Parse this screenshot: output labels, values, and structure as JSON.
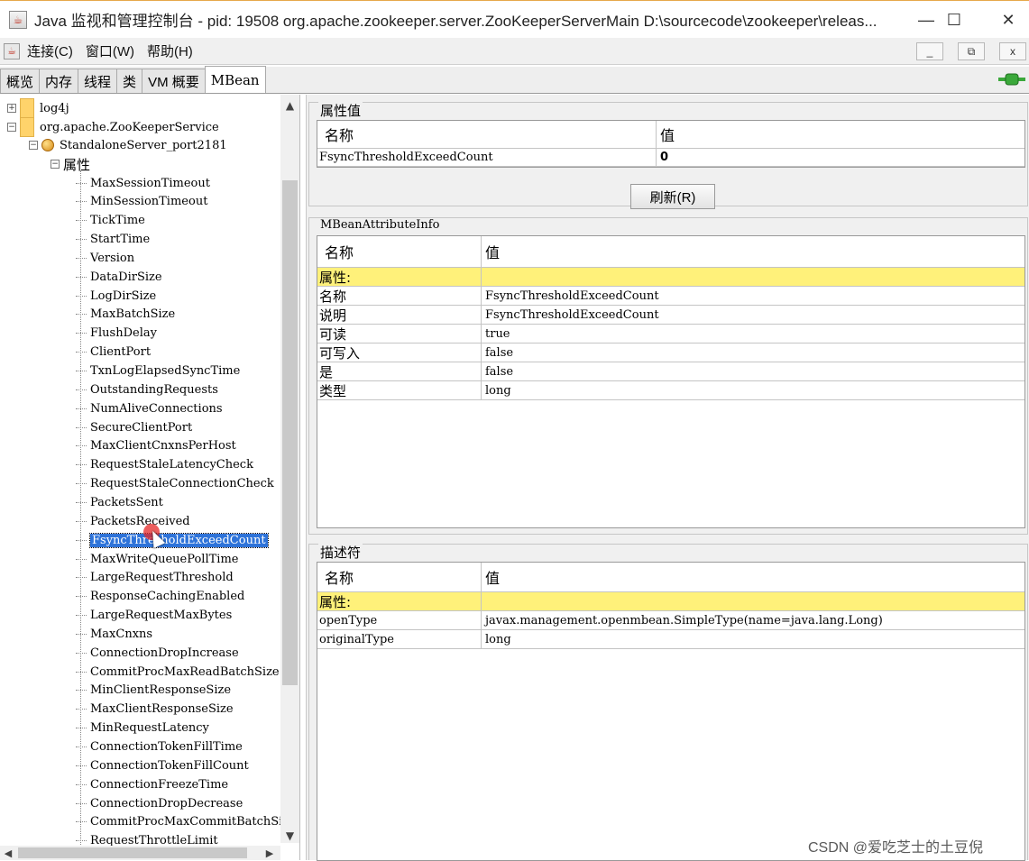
{
  "window": {
    "title": "Java 监视和管理控制台 - pid: 19508 org.apache.zookeeper.server.ZooKeeperServerMain D:\\sourcecode\\zookeeper\\releas...",
    "controls": {
      "minimize": "—",
      "maximize": "☐",
      "close": "✕"
    }
  },
  "menu": {
    "items": [
      "连接(C)",
      "窗口(W)",
      "帮助(H)"
    ],
    "mdi": {
      "minimize": "_",
      "restore": "⧉",
      "close": "x"
    }
  },
  "tabs": [
    "概览",
    "内存",
    "线程",
    "类",
    "VM 概要",
    "MBean"
  ],
  "active_tab": "MBean",
  "tree": {
    "nodes": {
      "log4j": "log4j",
      "service": "org.apache.ZooKeeperService",
      "server": "StandaloneServer_port2181",
      "attributes_folder": "属性"
    },
    "attributes": [
      "MaxSessionTimeout",
      "MinSessionTimeout",
      "TickTime",
      "StartTime",
      "Version",
      "DataDirSize",
      "LogDirSize",
      "MaxBatchSize",
      "FlushDelay",
      "ClientPort",
      "TxnLogElapsedSyncTime",
      "OutstandingRequests",
      "NumAliveConnections",
      "SecureClientPort",
      "MaxClientCnxnsPerHost",
      "RequestStaleLatencyCheck",
      "RequestStaleConnectionCheck",
      "PacketsSent",
      "PacketsReceived",
      "FsyncThresholdExceedCount",
      "MaxWriteQueuePollTime",
      "LargeRequestThreshold",
      "ResponseCachingEnabled",
      "LargeRequestMaxBytes",
      "MaxCnxns",
      "ConnectionDropIncrease",
      "CommitProcMaxReadBatchSize",
      "MinClientResponseSize",
      "MaxClientResponseSize",
      "MinRequestLatency",
      "ConnectionTokenFillTime",
      "ConnectionTokenFillCount",
      "ConnectionFreezeTime",
      "ConnectionDropDecrease",
      "CommitProcMaxCommitBatchSiz",
      "RequestThrottleLimit"
    ],
    "selected_index": 19
  },
  "attr_values": {
    "title": "属性值",
    "header": {
      "name": "名称",
      "value": "值"
    },
    "row": {
      "name": "FsyncThresholdExceedCount",
      "value": "0"
    },
    "refresh_label": "刷新(R)"
  },
  "attr_info": {
    "title": "MBeanAttributeInfo",
    "header": {
      "name": "名称",
      "value": "值"
    },
    "rows": [
      {
        "name": "属性:",
        "value": ""
      },
      {
        "name": "名称",
        "value": "FsyncThresholdExceedCount"
      },
      {
        "name": "说明",
        "value": "FsyncThresholdExceedCount"
      },
      {
        "name": "可读",
        "value": "true"
      },
      {
        "name": "可写入",
        "value": "false"
      },
      {
        "name": "是",
        "value": "false"
      },
      {
        "name": "类型",
        "value": "long"
      }
    ]
  },
  "descriptor": {
    "title": "描述符",
    "header": {
      "name": "名称",
      "value": "值"
    },
    "rows": [
      {
        "name": "属性:",
        "value": ""
      },
      {
        "name": "openType",
        "value": "javax.management.openmbean.SimpleType(name=java.lang.Long)"
      },
      {
        "name": "originalType",
        "value": "long"
      }
    ]
  },
  "watermark": "CSDN @爱吃芝士的土豆倪",
  "colors": {
    "selection": "#2e73d9",
    "highlight_row": "#fff17a",
    "connection": "#3aa83a"
  }
}
